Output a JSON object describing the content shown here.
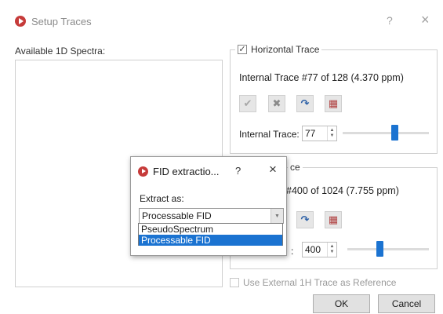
{
  "window": {
    "title": "Setup Traces",
    "help": "?",
    "close": "×"
  },
  "available_label": "Available 1D Spectra:",
  "horizontal": {
    "checkbox_mark": "✓",
    "label": "Horizontal Trace",
    "checked": true,
    "info": "Internal Trace #77 of 128 (4.370 ppm)",
    "field_label": "Internal Trace:",
    "value": "77",
    "slider_fraction": 0.6
  },
  "vertical": {
    "label_visible": "ce",
    "info_visible": "#400 of 1024 (7.755 ppm)",
    "field_label_visible": ":",
    "value": "400",
    "slider_fraction": 0.39
  },
  "toolbar_icons": [
    "ok-icon",
    "delete-icon",
    "redo-icon",
    "grid-icon"
  ],
  "external_check_label": "Use External 1H Trace as Reference",
  "buttons": {
    "ok": "OK",
    "cancel": "Cancel"
  },
  "fid_dialog": {
    "title": "FID extractio...",
    "help": "?",
    "close": "×",
    "extract_label": "Extract as:",
    "combo_value": "Processable FID",
    "options": [
      "PseudoSpectrum",
      "Processable FID"
    ],
    "selected_index": 1
  },
  "colors": {
    "accent": "#1b73d1",
    "app_icon": "#c63b3a"
  }
}
